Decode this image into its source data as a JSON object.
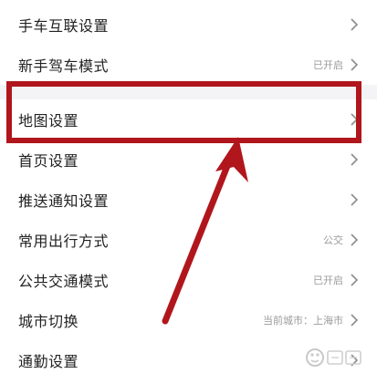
{
  "settings": {
    "items": [
      {
        "label": "手车互联设置",
        "value": ""
      },
      {
        "label": "新手驾车模式",
        "value": "已开启"
      },
      {
        "label": "地图设置",
        "value": ""
      },
      {
        "label": "首页设置",
        "value": ""
      },
      {
        "label": "推送通知设置",
        "value": ""
      },
      {
        "label": "常用出行方式",
        "value": "公交"
      },
      {
        "label": "公共交通模式",
        "value": "已开启"
      },
      {
        "label": "城市切换",
        "value": "当前城市：上海市"
      },
      {
        "label": "通勤设置",
        "value": ""
      }
    ]
  },
  "annotation": {
    "highlight_color": "#b0161c",
    "arrow_color": "#b0161c",
    "highlighted_item": "地图设置"
  },
  "icons": {
    "chevron": "chevron-right-icon",
    "watermark": "watermark-logo"
  }
}
